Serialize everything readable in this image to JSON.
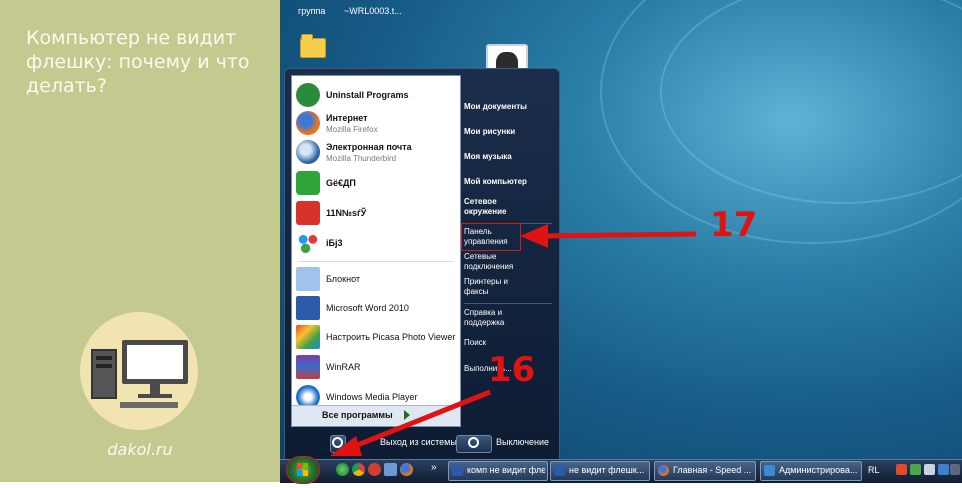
{
  "article": {
    "title": "Компьютер не видит флешку: почему и что делать?",
    "site": "dakol.ru"
  },
  "desktop": {
    "labels": [
      "группа",
      "~WRL0003.t..."
    ]
  },
  "start_menu": {
    "programs": [
      {
        "name": "Uninstall Programs",
        "sub": "",
        "icon": "uninstall-icon"
      },
      {
        "name": "Интернет",
        "sub": "Mozilla Firefox",
        "icon": "firefox-icon"
      },
      {
        "name": "Электронная почта",
        "sub": "Mozilla Thunderbird",
        "icon": "thunderbird-icon"
      },
      {
        "name": "Gё€ДП",
        "sub": "",
        "icon": "g-app-icon"
      },
      {
        "name": "11N№sѓЎ",
        "sub": "",
        "icon": "app-11-icon"
      },
      {
        "name": "iБj3",
        "sub": "",
        "icon": "dots-app-icon"
      },
      {
        "name": "Блокнот",
        "sub": "",
        "icon": "notepad-icon"
      },
      {
        "name": "Microsoft Word 2010",
        "sub": "",
        "icon": "word-icon"
      },
      {
        "name": "Настроить Picasa Photo Viewer",
        "sub": "",
        "icon": "picasa-icon"
      },
      {
        "name": "WinRAR",
        "sub": "",
        "icon": "winrar-icon"
      },
      {
        "name": "Windows Media Player",
        "sub": "",
        "icon": "media-player-icon"
      }
    ],
    "all_programs": "Все программы",
    "right_items": [
      "Мои документы",
      "Мои рисунки",
      "Моя музыка",
      "Мой компьютер",
      "Сетевое окружение",
      "Панель управления",
      "Сетевые подключения",
      "Принтеры и факсы",
      "Справка и поддержка",
      "Поиск",
      "Выполнить..."
    ],
    "logout": "Выход из системы",
    "shutdown": "Выключение"
  },
  "taskbar": {
    "tasks": [
      {
        "label": "комп не видит флеш...",
        "icon": "word-icon"
      },
      {
        "label": "не видит флешк...",
        "icon": "word-icon"
      },
      {
        "label": "Главная - Speed ...",
        "icon": "firefox-icon"
      },
      {
        "label": "Администрирова...",
        "icon": "admin-icon"
      }
    ],
    "language": "RL"
  },
  "annotations": {
    "arrow_start": "16",
    "arrow_panel": "17"
  },
  "colors": {
    "left_bg": "#c3c98f",
    "highlight": "#d11a1a"
  }
}
